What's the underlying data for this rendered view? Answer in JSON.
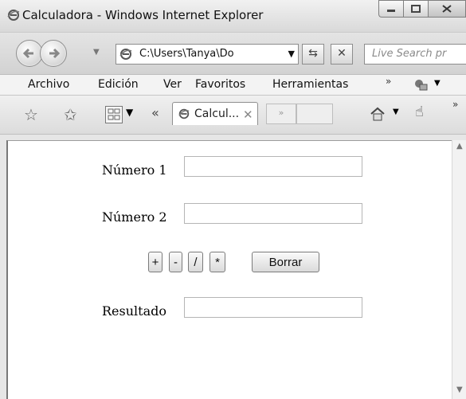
{
  "window": {
    "title": "Calculadora - Windows Internet Explorer",
    "icon": "ie-logo-icon"
  },
  "navigation": {
    "address": "C:\\Users\\Tanya\\Do",
    "search_placeholder": "Live Search pr"
  },
  "menubar": {
    "items": [
      {
        "label": "Archivo"
      },
      {
        "label": "Edición"
      },
      {
        "label": "Ver"
      },
      {
        "label": "Favoritos"
      },
      {
        "label": "Herramientas"
      }
    ],
    "more": "»"
  },
  "tabs": {
    "active": {
      "label": "Calcul...",
      "close": "✕"
    },
    "back": "«",
    "new_tab": "»"
  },
  "form": {
    "numero1_label": "Número 1",
    "numero2_label": "Número 2",
    "resultado_label": "Resultado",
    "numero1_value": "",
    "numero2_value": "",
    "resultado_value": "",
    "buttons": {
      "add": "+",
      "subtract": "-",
      "divide": "/",
      "multiply": "*",
      "clear": "Borrar"
    }
  }
}
